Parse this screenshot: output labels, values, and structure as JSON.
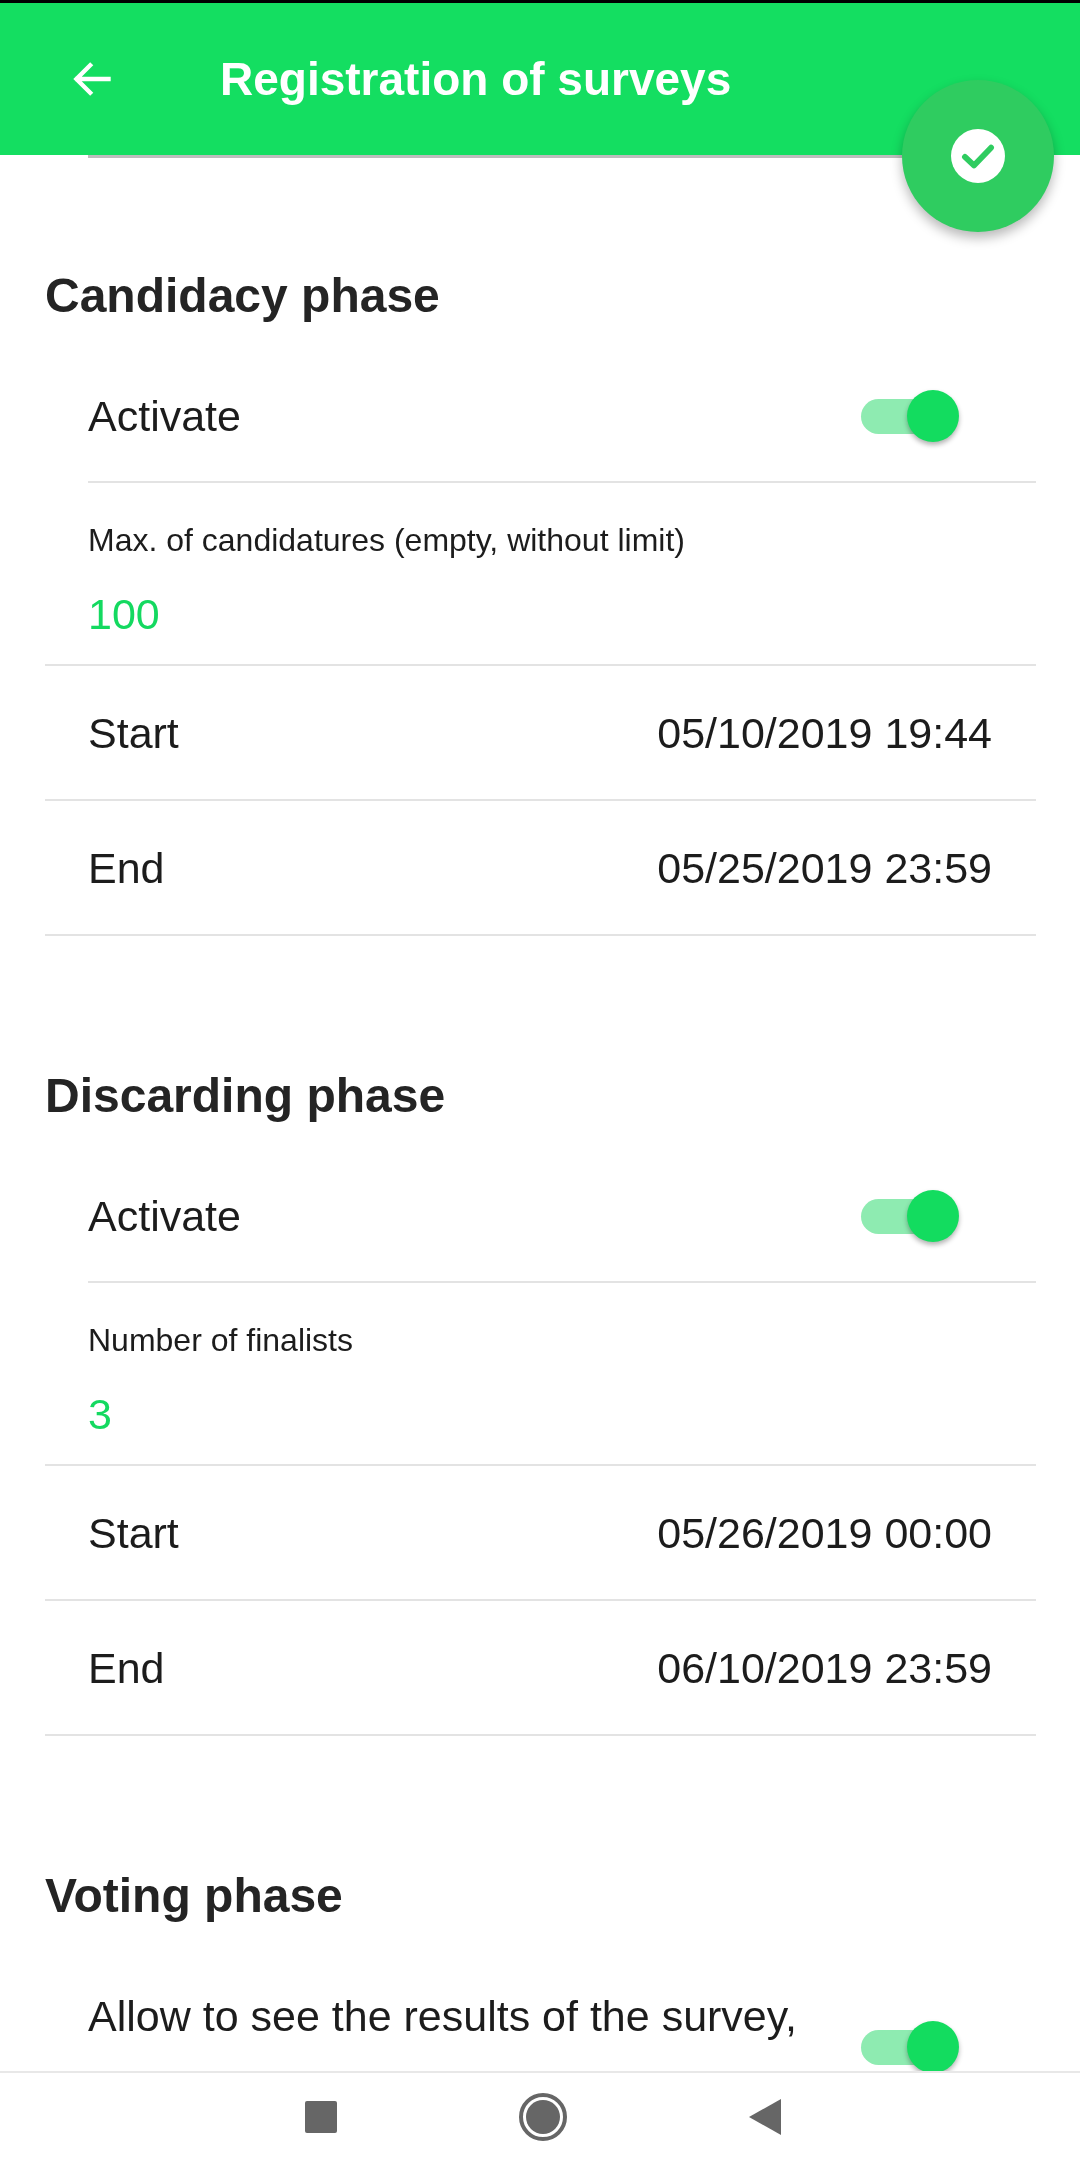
{
  "app_bar": {
    "title": "Registration of surveys"
  },
  "sections": [
    {
      "title": "Candidacy phase",
      "rows": [
        {
          "kind": "switch",
          "label": "Activate",
          "on": true
        },
        {
          "kind": "field",
          "label": "Max. of candidatures (empty, without limit)",
          "value": "100"
        },
        {
          "kind": "datetime",
          "label": "Start",
          "value": "05/10/2019 19:44"
        },
        {
          "kind": "datetime",
          "label": "End",
          "value": "05/25/2019 23:59"
        }
      ]
    },
    {
      "title": "Discarding phase",
      "rows": [
        {
          "kind": "switch",
          "label": "Activate",
          "on": true
        },
        {
          "kind": "field",
          "label": "Number of finalists",
          "value": "3"
        },
        {
          "kind": "datetime",
          "label": "Start",
          "value": "05/26/2019 00:00"
        },
        {
          "kind": "datetime",
          "label": "End",
          "value": "06/10/2019 23:59"
        }
      ]
    },
    {
      "title": "Voting phase",
      "rows": [
        {
          "kind": "long_switch",
          "label": "Allow to see the results of the survey,",
          "on": true
        }
      ]
    }
  ]
}
